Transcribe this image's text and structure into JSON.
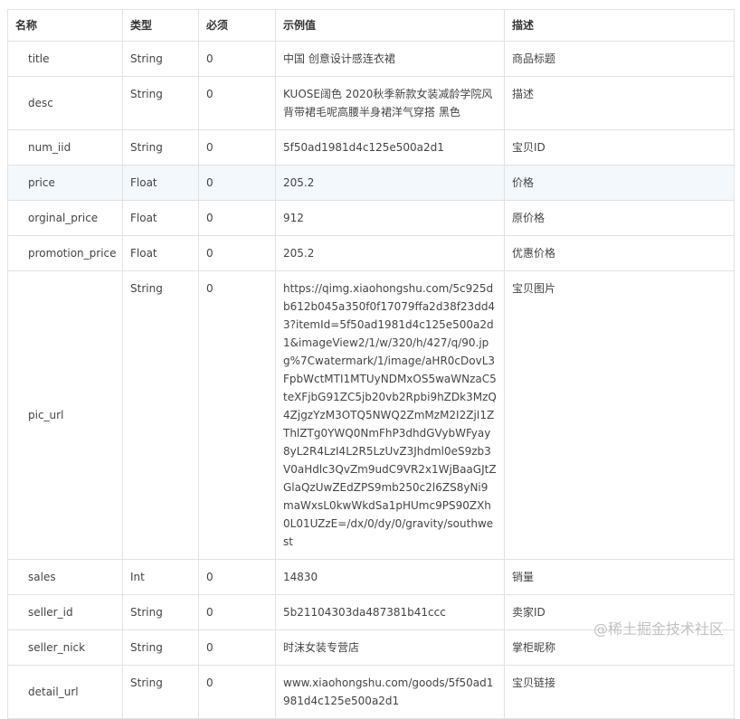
{
  "headers": [
    "名称",
    "类型",
    "必须",
    "示例值",
    "描述"
  ],
  "rows": [
    {
      "name": "title",
      "type": "String",
      "required": "0",
      "example": "中国 创意设计感连衣裙",
      "desc": "商品标题"
    },
    {
      "name": "desc",
      "type": "String",
      "required": "0",
      "example": "KUOSE阔色 2020秋季新款女装减龄学院风背带裙毛呢高腰半身裙洋气穿搭 黑色",
      "desc": "描述"
    },
    {
      "name": "num_iid",
      "type": "String",
      "required": "0",
      "example": "5f50ad1981d4c125e500a2d1",
      "desc": "宝贝ID"
    },
    {
      "name": "price",
      "type": "Float",
      "required": "0",
      "example": "205.2",
      "desc": "价格"
    },
    {
      "name": "orginal_price",
      "type": "Float",
      "required": "0",
      "example": "912",
      "desc": "原价格"
    },
    {
      "name": "promotion_price",
      "type": "Float",
      "required": "0",
      "example": "205.2",
      "desc": "优惠价格"
    },
    {
      "name": "pic_url",
      "type": "String",
      "required": "0",
      "example": "https://qimg.xiaohongshu.com/5c925db612b045a350f0f17079ffa2d38f23dd43?itemId=5f50ad1981d4c125e500a2d1&imageView2/1/w/320/h/427/q/90.jpg%7Cwatermark/1/image/aHR0cDovL3FpbWctMTI1MTUyNDMxOS5waWNzaC5teXFjbG91ZC5jb20vb2Rpbi9hZDk3MzQ4ZjgzYzM3OTQ5NWQ2ZmMzM2I2ZjI1ZThlZTg0YWQ0NmFhP3dhdGVybWFyay8yL2R4LzI4L2R5LzUvZ3Jhdml0eS9zb3V0aHdlc3QvZm9udC9VR2x1WjBaaGJtZGlaQzUwZEdZPS9mb250c2l6ZS8yNi9maWxsL0kwWkdSa1pHUmc9PS90ZXh0L01UZzE=/dx/0/dy/0/gravity/southwest",
      "desc": "宝贝图片"
    },
    {
      "name": "sales",
      "type": "Int",
      "required": "0",
      "example": "14830",
      "desc": "销量"
    },
    {
      "name": "seller_id",
      "type": "String",
      "required": "0",
      "example": "5b21104303da487381b41ccc",
      "desc": "卖家ID"
    },
    {
      "name": "seller_nick",
      "type": "String",
      "required": "0",
      "example": "时沫女装专营店",
      "desc": "掌柜昵称"
    },
    {
      "name": "detail_url",
      "type": "String",
      "required": "0",
      "example": "www.xiaohongshu.com/goods/5f50ad1981d4c125e500a2d1",
      "desc": "宝贝链接"
    }
  ],
  "highlighted_row": "price",
  "watermark": "@稀土掘金技术社区"
}
